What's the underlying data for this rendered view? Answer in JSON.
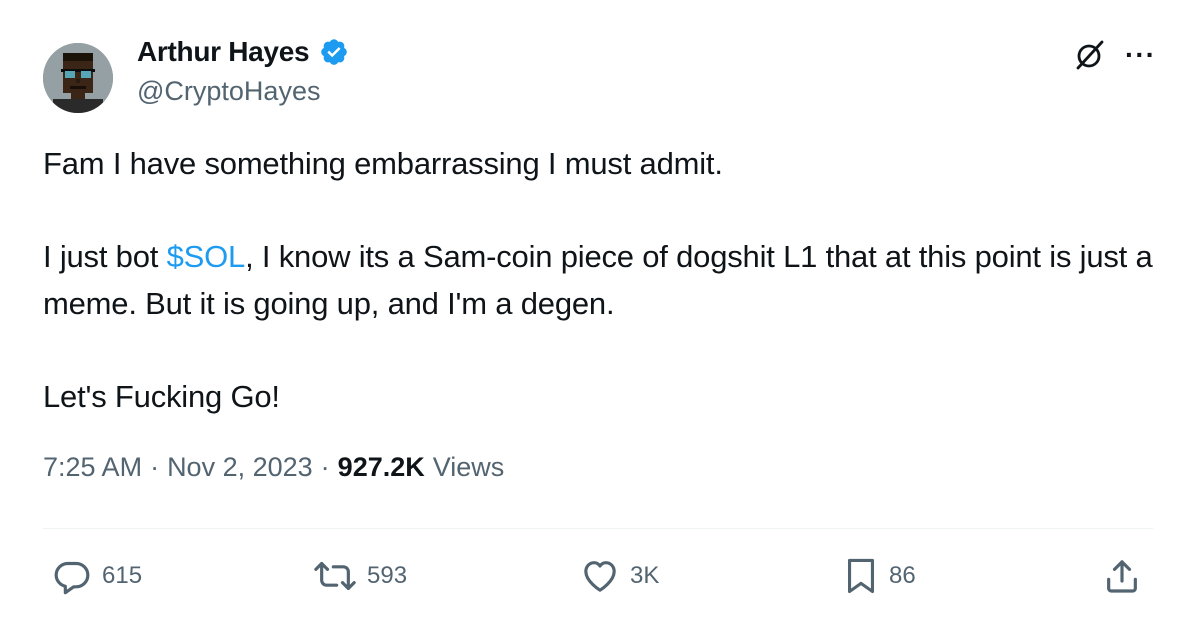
{
  "author": {
    "display_name": "Arthur Hayes",
    "handle": "@CryptoHayes",
    "verified": true
  },
  "top_actions": {
    "grok_icon": "grok-icon",
    "more_icon": "more-icon",
    "more_label": "···"
  },
  "tweet": {
    "line1": "Fam I have something embarrassing I must admit.",
    "line2_prefix": "I just bot ",
    "cashtag": "$SOL",
    "line2_suffix": ", I know its a Sam-coin piece of dogshit L1 that at this point is just a meme. But it is going up, and I'm a degen.",
    "line3": "Let's Fucking Go!"
  },
  "meta": {
    "time": "7:25 AM",
    "sep1": "·",
    "date": "Nov 2, 2023",
    "sep2": "·",
    "views_count": "927.2K",
    "views_label": "Views"
  },
  "actions": {
    "replies": "615",
    "reposts": "593",
    "likes": "3K",
    "bookmarks": "86"
  },
  "colors": {
    "accent": "#1d9bf0",
    "text": "#0f1419",
    "secondary": "#536471"
  }
}
